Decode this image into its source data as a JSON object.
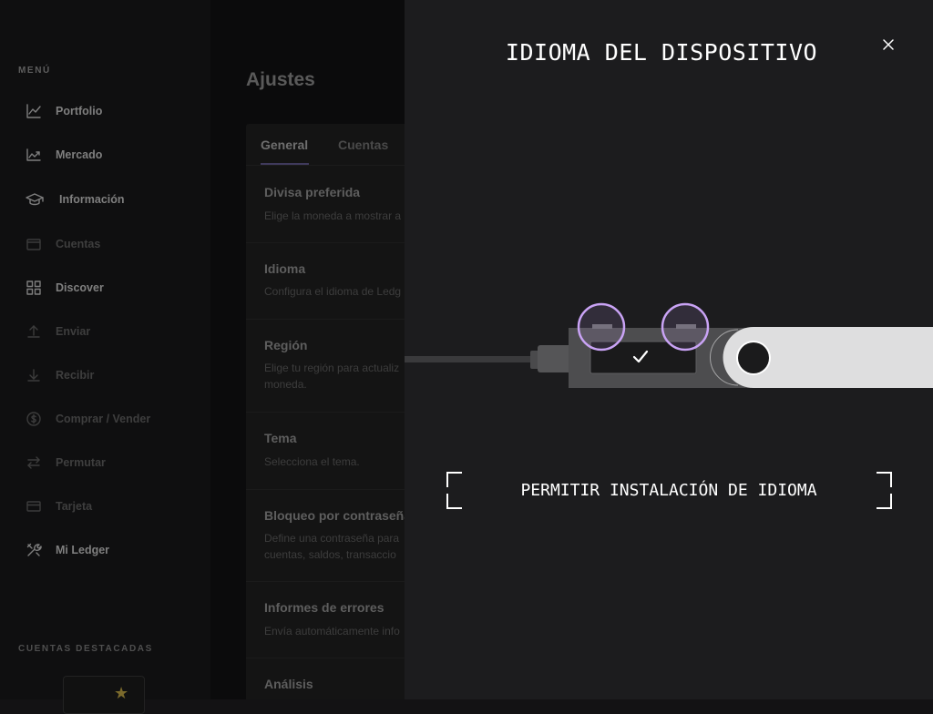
{
  "sidebar": {
    "menu_title": "MENÚ",
    "items": [
      {
        "label": "Portfolio",
        "icon": "chart-line-icon"
      },
      {
        "label": "Mercado",
        "icon": "market-chart-icon"
      },
      {
        "label": "Información",
        "icon": "graduation-cap-icon"
      },
      {
        "label": "Cuentas",
        "icon": "wallet-icon"
      },
      {
        "label": "Discover",
        "icon": "grid-icon"
      },
      {
        "label": "Enviar",
        "icon": "upload-arrow-icon"
      },
      {
        "label": "Recibir",
        "icon": "download-arrow-icon"
      },
      {
        "label": "Comprar / Vender",
        "icon": "dollar-circle-icon"
      },
      {
        "label": "Permutar",
        "icon": "swap-arrows-icon"
      },
      {
        "label": "Tarjeta",
        "icon": "card-icon"
      },
      {
        "label": "Mi Ledger",
        "icon": "tools-icon"
      }
    ],
    "starred_title": "CUENTAS DESTACADAS"
  },
  "main": {
    "page_title": "Ajustes",
    "tabs": [
      {
        "label": "General"
      },
      {
        "label": "Cuentas"
      }
    ],
    "settings": [
      {
        "title": "Divisa preferida",
        "desc": "Elige la moneda a mostrar a"
      },
      {
        "title": "Idioma",
        "desc": "Configura el idioma de Ledg"
      },
      {
        "title": "Región",
        "desc": "Elige tu región para actualiz",
        "desc2": "moneda."
      },
      {
        "title": "Tema",
        "desc": "Selecciona el tema."
      },
      {
        "title": "Bloqueo por contraseña",
        "desc": "Define una contraseña para",
        "desc2": "cuentas, saldos, transaccio"
      },
      {
        "title": "Informes de errores",
        "desc": "Envía automáticamente info"
      },
      {
        "title": "Análisis",
        "desc": ""
      }
    ]
  },
  "drawer": {
    "title": "IDIOMA DEL DISPOSITIVO",
    "close_icon": "close-icon",
    "instruction": "PERMITIR INSTALACIÓN DE IDIOMA",
    "device_screen_icon": "checkmark-icon",
    "colors": {
      "button_highlight": "#c9a3f5",
      "background": "#1c1c1e"
    }
  }
}
